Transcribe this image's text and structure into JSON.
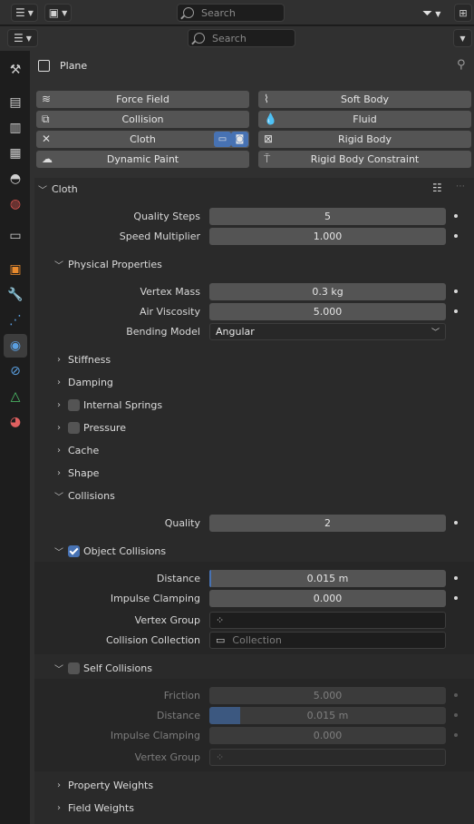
{
  "header": {
    "search_placeholder": "Search"
  },
  "properties": {
    "search_placeholder": "Search",
    "object_name": "Plane"
  },
  "physics_buttons": {
    "force_field": "Force Field",
    "soft_body": "Soft Body",
    "collision": "Collision",
    "fluid": "Fluid",
    "cloth": "Cloth",
    "rigid_body": "Rigid Body",
    "dynamic_paint": "Dynamic Paint",
    "rigid_body_constraint": "Rigid Body Constraint"
  },
  "cloth": {
    "title": "Cloth",
    "quality_steps_label": "Quality Steps",
    "quality_steps_value": "5",
    "speed_multiplier_label": "Speed Multiplier",
    "speed_multiplier_value": "1.000",
    "physical_properties": {
      "title": "Physical Properties",
      "vertex_mass_label": "Vertex Mass",
      "vertex_mass_value": "0.3 kg",
      "air_viscosity_label": "Air Viscosity",
      "air_viscosity_value": "5.000",
      "bending_model_label": "Bending Model",
      "bending_model_value": "Angular"
    },
    "stiffness": "Stiffness",
    "damping": "Damping",
    "internal_springs": "Internal Springs",
    "pressure": "Pressure",
    "cache": "Cache",
    "shape": "Shape",
    "collisions": {
      "title": "Collisions",
      "quality_label": "Quality",
      "quality_value": "2",
      "object_collisions": {
        "title": "Object Collisions",
        "enabled": true,
        "distance_label": "Distance",
        "distance_value": "0.015 m",
        "impulse_clamping_label": "Impulse Clamping",
        "impulse_clamping_value": "0.000",
        "vertex_group_label": "Vertex Group",
        "vertex_group_value": "",
        "collision_collection_label": "Collision Collection",
        "collision_collection_placeholder": "Collection"
      },
      "self_collisions": {
        "title": "Self Collisions",
        "enabled": false,
        "friction_label": "Friction",
        "friction_value": "5.000",
        "distance_label": "Distance",
        "distance_value": "0.015 m",
        "distance_fill": 0.13,
        "impulse_clamping_label": "Impulse Clamping",
        "impulse_clamping_value": "0.000",
        "vertex_group_label": "Vertex Group",
        "vertex_group_value": ""
      }
    },
    "property_weights": "Property Weights",
    "field_weights": "Field Weights"
  },
  "colors": {
    "accent": "#4772b3",
    "panel": "#303030",
    "field": "#545454"
  }
}
